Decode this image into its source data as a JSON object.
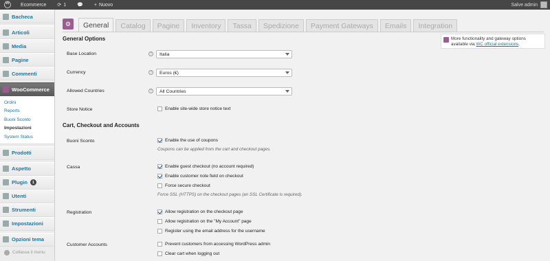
{
  "adminbar": {
    "site_name": "Ecommerce",
    "updates_count": "1",
    "new_label": "Nuovo",
    "user_greeting": "Salve admin"
  },
  "sidebar": {
    "items": [
      {
        "label": "Bacheca"
      },
      {
        "label": "Articoli"
      },
      {
        "label": "Media"
      },
      {
        "label": "Pagine"
      },
      {
        "label": "Commenti"
      },
      {
        "label": "WooCommerce"
      },
      {
        "label": "Prodotti"
      },
      {
        "label": "Aspetto"
      },
      {
        "label": "Plugin",
        "badge": "1"
      },
      {
        "label": "Utenti"
      },
      {
        "label": "Strumenti"
      },
      {
        "label": "Impostazioni"
      },
      {
        "label": "Opzioni tema"
      }
    ],
    "woocommerce_submenu": [
      "Ordini",
      "Reports",
      "Buoni Sconto",
      "Impostazioni",
      "System Status"
    ],
    "collapse_label": "Collassa il menu"
  },
  "tabs": [
    "General",
    "Catalog",
    "Pagine",
    "Inventory",
    "Tassa",
    "Spedizione",
    "Payment Gateways",
    "Emails",
    "Integration"
  ],
  "notice": {
    "text_before": "More functionality and gateway options available via ",
    "link": "WC official extensions",
    "text_after": "."
  },
  "general_options": {
    "title": "General Options",
    "base_location": {
      "label": "Base Location",
      "value": "Italia"
    },
    "currency": {
      "label": "Currency",
      "value": "Euros (€)"
    },
    "allowed_countries": {
      "label": "Allowed Countries",
      "value": "All Countries"
    },
    "store_notice": {
      "label": "Store Notice",
      "checkbox": "Enable site-wide store notice text",
      "checked": false
    }
  },
  "cart_section": {
    "title": "Cart, Checkout and Accounts",
    "coupons": {
      "label": "Buoni Sconto",
      "checkbox": "Enable the use of coupons",
      "checked": true,
      "desc": "Coupons can be applied from the cart and checkout pages."
    },
    "cassa": {
      "label": "Cassa",
      "options": [
        {
          "text": "Enable guest checkout (no account required)",
          "checked": true
        },
        {
          "text": "Enable customer note field on checkout",
          "checked": true
        },
        {
          "text": "Force secure checkout",
          "checked": false
        }
      ],
      "desc": "Force SSL (HTTPS) on the checkout pages (an SSL Certificate is required)."
    },
    "registration": {
      "label": "Registration",
      "options": [
        {
          "text": "Allow registration on the checkout page",
          "checked": true
        },
        {
          "text": "Allow registration on the \"My Account\" page",
          "checked": false
        },
        {
          "text": "Register using the email address for the username",
          "checked": false
        }
      ]
    },
    "customer_accounts": {
      "label": "Customer Accounts",
      "options": [
        {
          "text": "Prevent customers from accessing WordPress admin",
          "checked": false
        },
        {
          "text": "Clear cart when logging out",
          "checked": false
        }
      ]
    }
  }
}
